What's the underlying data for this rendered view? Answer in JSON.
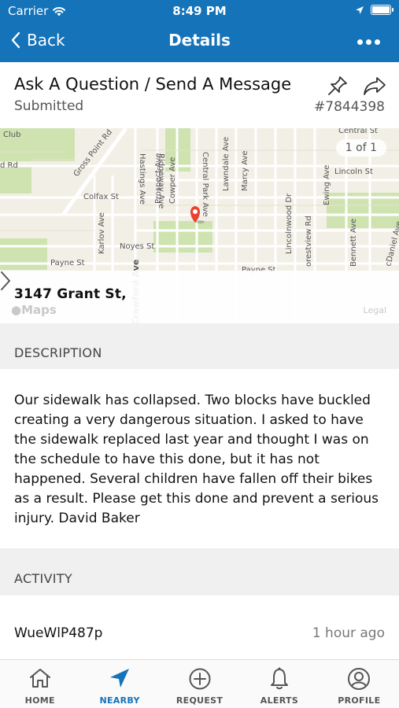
{
  "status_bar": {
    "carrier": "Carrier",
    "time": "8:49 PM"
  },
  "nav": {
    "back_label": "Back",
    "title": "Details",
    "more_icon": "more-horizontal-icon"
  },
  "request": {
    "title": "Ask A Question / Send A Message",
    "status": "Submitted",
    "id": "#7844398",
    "pin_icon": "pin-icon",
    "share_icon": "share-icon"
  },
  "map": {
    "page_indicator": "1 of 1",
    "address": "3147   Grant St,",
    "maps_label": "Maps",
    "legal_label": "Legal",
    "streets": {
      "club": "Club",
      "central_st": "Central St",
      "gross_point_rd": "Gross Point Rd",
      "rd": "d Rd",
      "prospect_ave": "Prospect Ave",
      "cowper_ave": "Cowper Ave",
      "hastings_ave": "Hastings Ave",
      "ridgeway_ave": "Ridgeway Ave",
      "lawndale_ave": "Lawndale Ave",
      "marcy_ave": "Marcy Ave",
      "central_park_ave": "Central Park Ave",
      "lincoln_st": "Lincoln St",
      "colfax_st": "Colfax St",
      "ewing_ave": "Ewing Ave",
      "karlov_ave": "Karlov Ave",
      "lincolnwood_dr": "Lincolnwood Dr",
      "crestview_rd": "orestview Rd",
      "noyes_st": "Noyes St",
      "payne_st": "Payne St",
      "payne_st_2": "Payne St",
      "crawford_ave": "Crawford Ave",
      "bennett_ave": "Bennett Ave",
      "mcdaniel_ave": "cDaniel Ave"
    },
    "pin_color": "#e8432f"
  },
  "sections": {
    "description_header": "DESCRIPTION",
    "description_text": "Our sidewalk has collapsed. Two blocks have buckled creating a very dangerous situation. I asked to have the sidewalk replaced last year and thought I was on the schedule to have this done, but it has not happened. Several children have fallen off their bikes as a result. Please get this done and prevent a serious injury.  David Baker",
    "activity_header": "ACTIVITY"
  },
  "activity": [
    {
      "user": "WueWlP487p",
      "time": "1 hour ago"
    }
  ],
  "tabs": [
    {
      "label": "HOME",
      "icon": "home-icon"
    },
    {
      "label": "NEARBY",
      "icon": "location-arrow-icon",
      "active": true
    },
    {
      "label": "REQUEST",
      "icon": "plus-circle-icon"
    },
    {
      "label": "ALERTS",
      "icon": "bell-icon"
    },
    {
      "label": "PROFILE",
      "icon": "user-circle-icon"
    }
  ],
  "colors": {
    "brand": "#1473b9",
    "section_bg": "#f0f0f0"
  }
}
